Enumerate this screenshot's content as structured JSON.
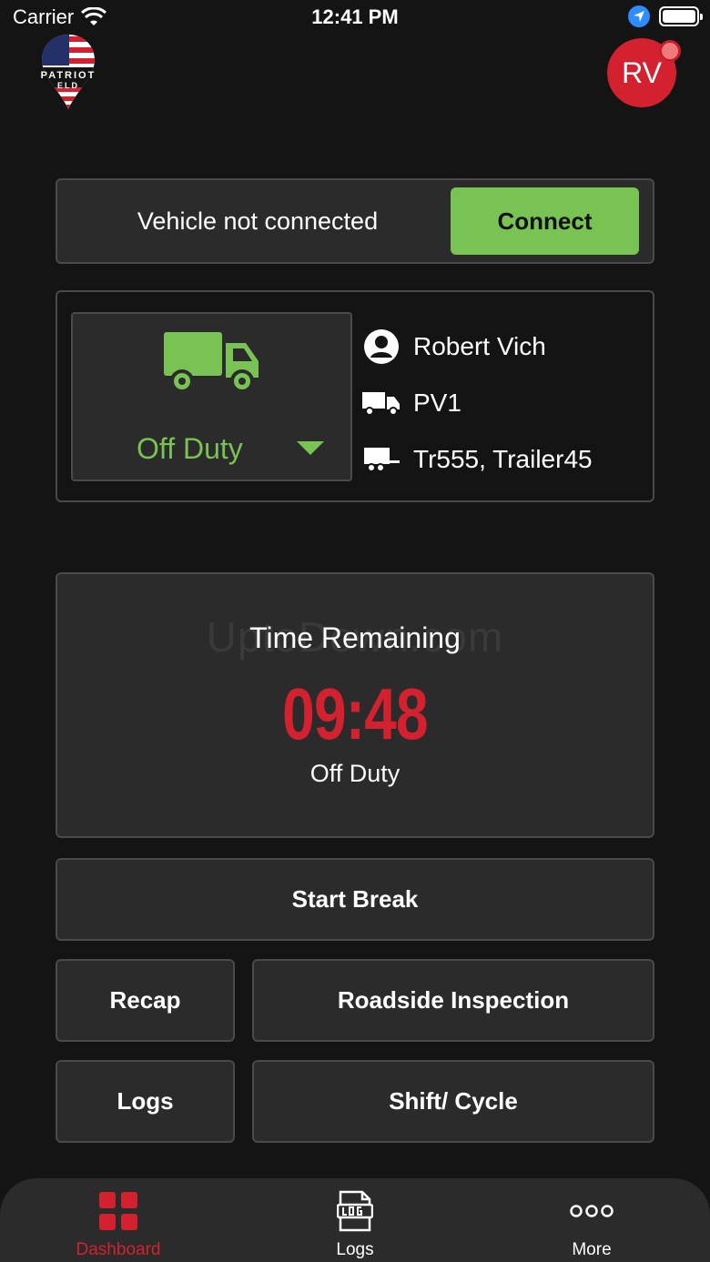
{
  "status_bar": {
    "carrier": "Carrier",
    "time": "12:41 PM"
  },
  "header": {
    "logo_text": "PATRIOT",
    "logo_sub": "ELD",
    "avatar_initials": "RV"
  },
  "connection": {
    "status_text": "Vehicle not connected",
    "connect_label": "Connect"
  },
  "status_card": {
    "duty_status": "Off Duty",
    "driver_name": "Robert Vich",
    "vehicle": "PV1",
    "trailers": "Tr555, Trailer45"
  },
  "time_panel": {
    "watermark": "UptoDown.com",
    "title": "Time Remaining",
    "value": "09:48",
    "status": "Off Duty"
  },
  "buttons": {
    "start_break": "Start Break",
    "recap": "Recap",
    "roadside": "Roadside Inspection",
    "logs": "Logs",
    "shift_cycle": "Shift/ Cycle"
  },
  "tabs": [
    {
      "label": "Dashboard",
      "icon": "dashboard-grid-icon",
      "active": true
    },
    {
      "label": "Logs",
      "icon": "log-document-icon",
      "active": false
    },
    {
      "label": "More",
      "icon": "more-dots-icon",
      "active": false
    }
  ],
  "colors": {
    "accent_red": "#d32130",
    "accent_green": "#79c254",
    "background": "#141414",
    "panel": "#2b2b2b"
  }
}
